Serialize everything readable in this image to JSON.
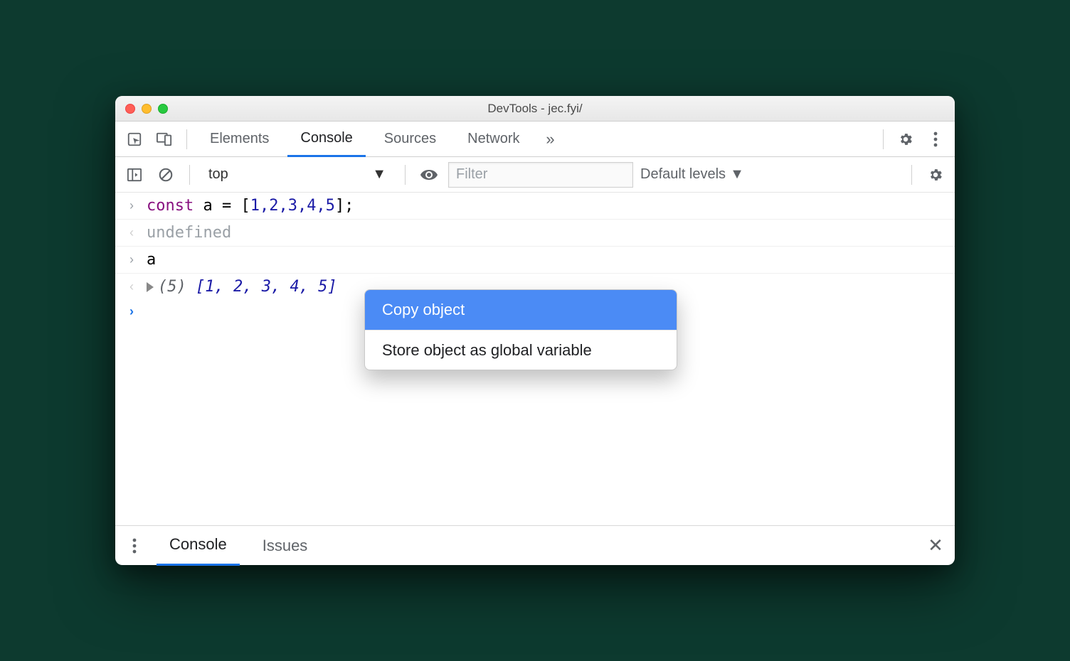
{
  "window": {
    "title": "DevTools - jec.fyi/"
  },
  "tabs": {
    "elements": "Elements",
    "console": "Console",
    "sources": "Sources",
    "network": "Network"
  },
  "consoleToolbar": {
    "context": "top",
    "filterPlaceholder": "Filter",
    "levels": "Default levels"
  },
  "consoleLines": {
    "input1_kw": "const",
    "input1_rest": " a = [",
    "input1_nums": "1,2,3,4,5",
    "input1_close": "];",
    "output1": "undefined",
    "input2": "a",
    "resultPrefix": "(5) ",
    "resultOpen": "[",
    "resultVals": "1, 2, 3, 4, 5",
    "resultClose": "]"
  },
  "contextMenu": {
    "copy": "Copy object",
    "store": "Store object as global variable"
  },
  "drawer": {
    "console": "Console",
    "issues": "Issues"
  }
}
